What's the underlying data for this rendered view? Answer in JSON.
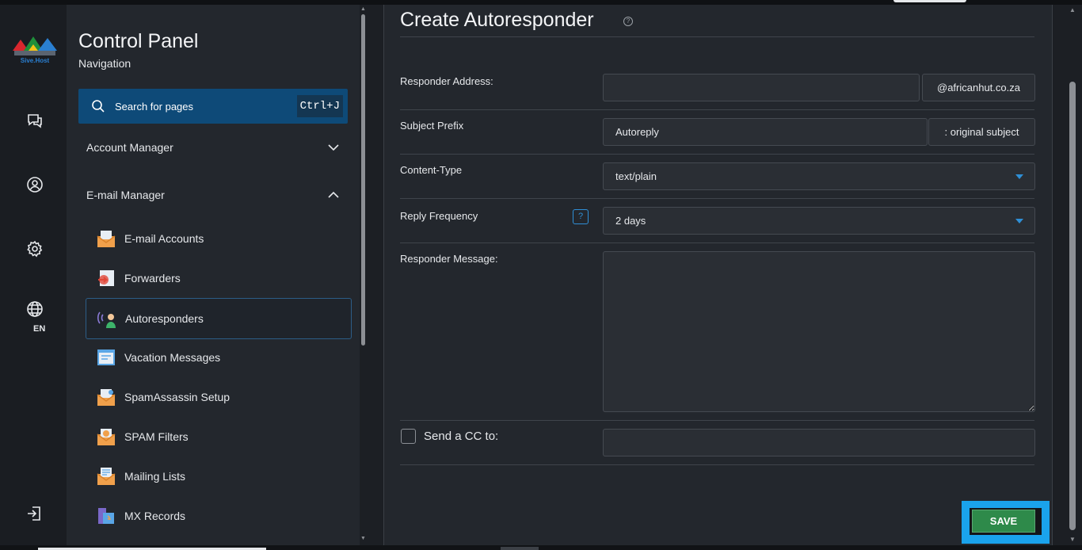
{
  "brand": {
    "logo_text": "Sive.Host"
  },
  "rail": {
    "language": "EN"
  },
  "nav": {
    "title": "Control Panel",
    "subtitle": "Navigation",
    "search": {
      "placeholder": "Search for pages",
      "shortcut": "Ctrl+J"
    },
    "sections": [
      {
        "label": "Account Manager",
        "expanded": false
      },
      {
        "label": "E-mail Manager",
        "expanded": true
      }
    ],
    "items": [
      {
        "label": "E-mail Accounts",
        "icon": "email-accounts-icon"
      },
      {
        "label": "Forwarders",
        "icon": "forwarders-icon"
      },
      {
        "label": "Autoresponders",
        "icon": "autoresponders-icon",
        "active": true
      },
      {
        "label": "Vacation Messages",
        "icon": "vacation-messages-icon"
      },
      {
        "label": "SpamAssassin Setup",
        "icon": "spamassassin-icon"
      },
      {
        "label": "SPAM Filters",
        "icon": "spam-filters-icon"
      },
      {
        "label": "Mailing Lists",
        "icon": "mailing-lists-icon"
      },
      {
        "label": "MX Records",
        "icon": "mx-records-icon"
      }
    ]
  },
  "form": {
    "title": "Create Autoresponder",
    "responder_address": {
      "label": "Responder Address:",
      "value": "",
      "domain": "@africanhut.co.za"
    },
    "subject_prefix": {
      "label": "Subject Prefix",
      "value": "Autoreply",
      "suffix": ": original subject"
    },
    "content_type": {
      "label": "Content-Type",
      "selected": "text/plain"
    },
    "reply_frequency": {
      "label": "Reply Frequency",
      "help": "?",
      "selected": "2 days"
    },
    "responder_message": {
      "label": "Responder Message:",
      "value": ""
    },
    "send_cc": {
      "label": "Send a CC to:",
      "checked": false,
      "value": ""
    },
    "save_label": "SAVE"
  },
  "colors": {
    "accent": "#0e4a78",
    "save": "#2e8a4a",
    "highlight": "#1aa3ec"
  }
}
